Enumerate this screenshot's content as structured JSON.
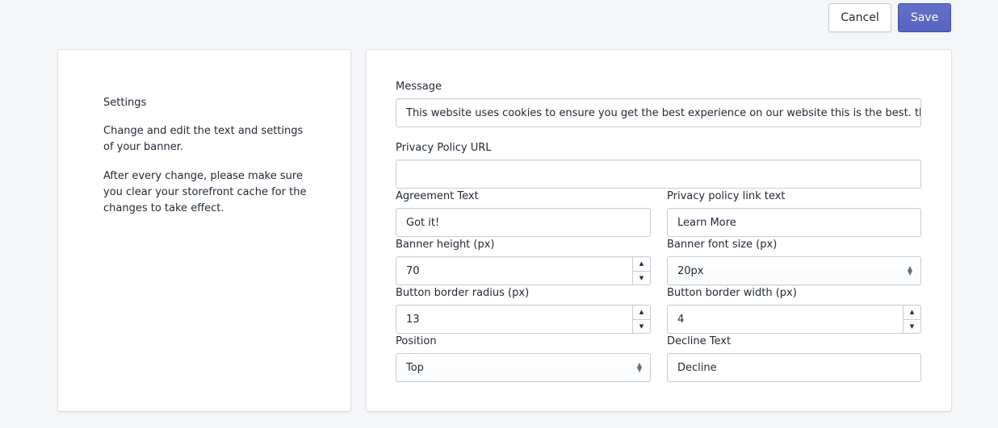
{
  "toolbar": {
    "cancel_label": "Cancel",
    "save_label": "Save"
  },
  "sidebar": {
    "title": "Settings",
    "description_1": "Change and edit the text and settings of your banner.",
    "description_2": "After every change, please make sure you clear your storefront cache for the changes to take effect."
  },
  "form": {
    "message": {
      "label": "Message",
      "value": "This website uses cookies to ensure you get the best experience on our website this is the best. thank"
    },
    "privacy_url": {
      "label": "Privacy Policy URL",
      "value": ""
    },
    "agreement_text": {
      "label": "Agreement Text",
      "value": "Got it!"
    },
    "privacy_link_text": {
      "label": "Privacy policy link text",
      "value": "Learn More"
    },
    "banner_height": {
      "label": "Banner height (px)",
      "value": "70"
    },
    "banner_font_size": {
      "label": "Banner font size (px)",
      "value": "20px"
    },
    "button_border_radius": {
      "label": "Button border radius (px)",
      "value": "13"
    },
    "button_border_width": {
      "label": "Button border width (px)",
      "value": "4"
    },
    "position": {
      "label": "Position",
      "value": "Top"
    },
    "decline_text": {
      "label": "Decline Text",
      "value": "Decline"
    }
  },
  "icons": {
    "stepper_up": "▲",
    "stepper_down": "▼",
    "select_up": "▲",
    "select_down": "▼"
  },
  "colors": {
    "primary": "#5c6ac4",
    "background": "#f4f6f8"
  }
}
